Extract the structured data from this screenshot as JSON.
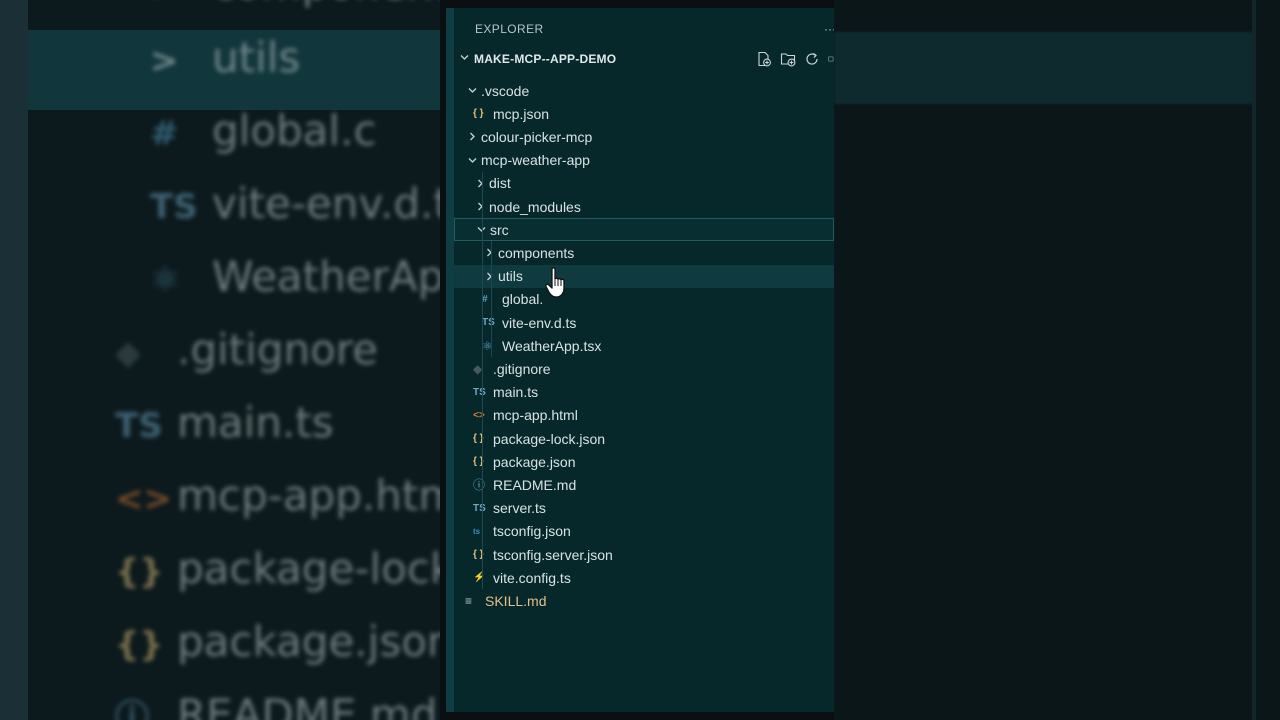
{
  "explorer": {
    "title": "EXPLORER",
    "more": "···",
    "workspace": "MAKE-MCP--APP-DEMO"
  },
  "tree": [
    {
      "id": "vscode",
      "name": ".vscode",
      "type": "folder",
      "open": true,
      "level": 0,
      "icon": "chevron-down-icon"
    },
    {
      "id": "mcp-json",
      "name": "mcp.json",
      "type": "file",
      "level": 1,
      "icon": "json-icon",
      "glyph": "{ }",
      "color": "#e5c07b"
    },
    {
      "id": "colour-picker-mcp",
      "name": "colour-picker-mcp",
      "type": "folder",
      "open": false,
      "level": 0,
      "icon": "chevron-right-icon"
    },
    {
      "id": "mcp-weather-app",
      "name": "mcp-weather-app",
      "type": "folder",
      "open": true,
      "level": 0,
      "icon": "chevron-down-icon"
    },
    {
      "id": "dist",
      "name": "dist",
      "type": "folder",
      "open": false,
      "level": 1,
      "icon": "chevron-right-icon"
    },
    {
      "id": "node-modules",
      "name": "node_modules",
      "type": "folder",
      "open": false,
      "level": 1,
      "icon": "chevron-right-icon"
    },
    {
      "id": "src",
      "name": "src",
      "type": "folder",
      "open": true,
      "level": 1,
      "icon": "chevron-down-icon",
      "state": "focused"
    },
    {
      "id": "components",
      "name": "components",
      "type": "folder",
      "open": false,
      "level": 2,
      "icon": "chevron-right-icon"
    },
    {
      "id": "utils",
      "name": "utils",
      "type": "folder",
      "open": false,
      "level": 2,
      "icon": "chevron-right-icon",
      "state": "hover"
    },
    {
      "id": "global-css",
      "name": "global.",
      "type": "file",
      "level": 2,
      "icon": "hash-icon",
      "glyph": "#",
      "color": "#56a3c9"
    },
    {
      "id": "vite-env",
      "name": "vite-env.d.ts",
      "type": "file",
      "level": 2,
      "icon": "typescript-icon",
      "glyph": "TS",
      "color": "#6ea6c8"
    },
    {
      "id": "weatherapp",
      "name": "WeatherApp.tsx",
      "type": "file",
      "level": 2,
      "icon": "react-icon",
      "glyph": "⚛",
      "color": "#5aa6c4"
    },
    {
      "id": "gitignore",
      "name": ".gitignore",
      "type": "file",
      "level": 1,
      "icon": "git-icon",
      "glyph": "◆",
      "color": "#4a5a5e"
    },
    {
      "id": "main-ts",
      "name": "main.ts",
      "type": "file",
      "level": 1,
      "icon": "typescript-icon",
      "glyph": "TS",
      "color": "#6ea6c8"
    },
    {
      "id": "mcp-app-html",
      "name": "mcp-app.html",
      "type": "file",
      "level": 1,
      "icon": "html-icon",
      "glyph": "<>",
      "color": "#e37933"
    },
    {
      "id": "package-lock",
      "name": "package-lock.json",
      "type": "file",
      "level": 1,
      "icon": "json-icon",
      "glyph": "{ }",
      "color": "#e5c07b"
    },
    {
      "id": "package-json",
      "name": "package.json",
      "type": "file",
      "level": 1,
      "icon": "json-icon",
      "glyph": "{ }",
      "color": "#e5c07b"
    },
    {
      "id": "readme",
      "name": "README.md",
      "type": "file",
      "level": 1,
      "icon": "info-icon",
      "glyph": "ⓘ",
      "color": "#6ea6c8"
    },
    {
      "id": "server-ts",
      "name": "server.ts",
      "type": "file",
      "level": 1,
      "icon": "typescript-icon",
      "glyph": "TS",
      "color": "#6ea6c8"
    },
    {
      "id": "tsconfig",
      "name": "tsconfig.json",
      "type": "file",
      "level": 1,
      "icon": "tsconfig-icon",
      "glyph": "ts",
      "color": "#3c8bb8"
    },
    {
      "id": "tsconfig-server",
      "name": "tsconfig.server.json",
      "type": "file",
      "level": 1,
      "icon": "json-icon",
      "glyph": "{ }",
      "color": "#e5c07b"
    },
    {
      "id": "vite-config",
      "name": "vite.config.ts",
      "type": "file",
      "level": 1,
      "icon": "vite-icon",
      "glyph": "⚡",
      "color": "#f2d341"
    },
    {
      "id": "skill-md",
      "name": "SKILL.md",
      "type": "file",
      "level": 0,
      "icon": "markdown-lines-icon",
      "glyph": "≡",
      "color": "#b7c6c8",
      "nameColor": "#e2c08d"
    }
  ],
  "background": {
    "rows": [
      {
        "text": "components",
        "glyph": ">",
        "color": "#cfd8da"
      },
      {
        "text": "utils",
        "glyph": ">",
        "color": "#cfd8da"
      },
      {
        "text": "global.c",
        "glyph": "#",
        "color": "#56a3c9"
      },
      {
        "text": "vite-env.d.ts",
        "glyph": "TS",
        "color": "#6ea6c8"
      },
      {
        "text": "WeatherApp",
        "glyph": "⚛",
        "color": "#5aa6c4"
      },
      {
        "text": ".gitignore",
        "glyph": "◆",
        "color": "#4a5a5e"
      },
      {
        "text": "main.ts",
        "glyph": "TS",
        "color": "#6ea6c8"
      },
      {
        "text": "mcp-app.htm",
        "glyph": "<>",
        "color": "#e37933"
      },
      {
        "text": "package-lock",
        "glyph": "{}",
        "color": "#e5c07b"
      },
      {
        "text": "package.json",
        "glyph": "{}",
        "color": "#e5c07b"
      },
      {
        "text": "README.md",
        "glyph": "ⓘ",
        "color": "#6ea6c8"
      }
    ]
  }
}
